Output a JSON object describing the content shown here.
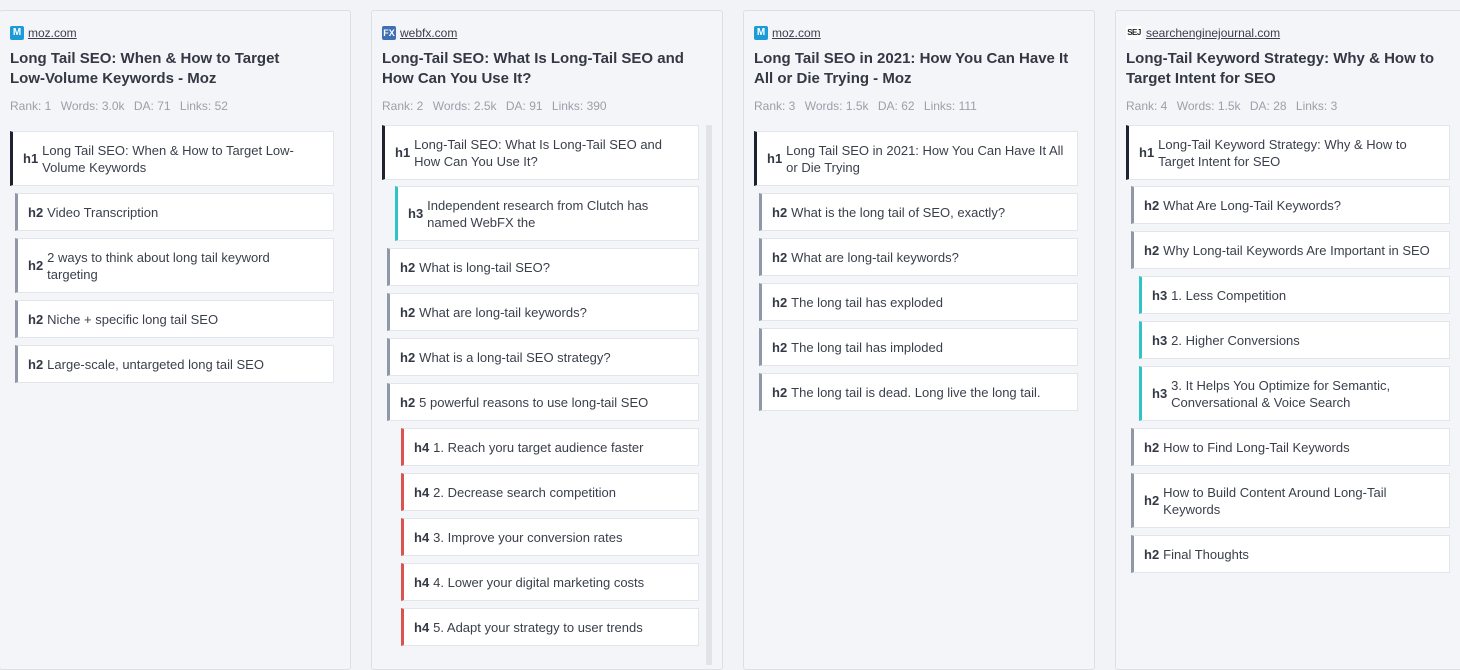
{
  "columns": [
    {
      "favicon": "moz-icon",
      "favicon_text": "M",
      "domain": "moz.com",
      "title": "Long Tail SEO: When & How to Target Low-Volume Keywords - Moz",
      "stats": {
        "rank": "Rank: 1",
        "words": "Words: 3.0k",
        "da": "DA: 71",
        "links": "Links: 52"
      },
      "headings": [
        {
          "tag": "h1",
          "text": "Long Tail SEO: When & How to Target Low-Volume Keywords"
        },
        {
          "tag": "h2",
          "text": "Video Transcription"
        },
        {
          "tag": "h2",
          "text": "2 ways to think about long tail keyword targeting"
        },
        {
          "tag": "h2",
          "text": "Niche + specific long tail SEO"
        },
        {
          "tag": "h2",
          "text": "Large-scale, untargeted long tail SEO"
        }
      ]
    },
    {
      "favicon": "webfx-icon",
      "favicon_text": "FX",
      "domain": "webfx.com",
      "title": "Long-Tail SEO: What Is Long-Tail SEO and How Can You Use It?",
      "stats": {
        "rank": "Rank: 2",
        "words": "Words: 2.5k",
        "da": "DA: 91",
        "links": "Links: 390"
      },
      "headings": [
        {
          "tag": "h1",
          "text": "Long-Tail SEO: What Is Long-Tail SEO and How Can You Use It?"
        },
        {
          "tag": "h3",
          "text": "Independent research from Clutch has named WebFX the"
        },
        {
          "tag": "h2",
          "text": "What is long-tail SEO?"
        },
        {
          "tag": "h2",
          "text": "What are long-tail keywords?"
        },
        {
          "tag": "h2",
          "text": "What is a long-tail SEO strategy?"
        },
        {
          "tag": "h2",
          "text": "5 powerful reasons to use long-tail SEO"
        },
        {
          "tag": "h4",
          "text": "1. Reach yoru target audience faster"
        },
        {
          "tag": "h4",
          "text": "2. Decrease search competition"
        },
        {
          "tag": "h4",
          "text": "3. Improve your conversion rates"
        },
        {
          "tag": "h4",
          "text": "4. Lower your digital marketing costs"
        },
        {
          "tag": "h4",
          "text": "5. Adapt your strategy to user trends"
        }
      ]
    },
    {
      "favicon": "moz-icon",
      "favicon_text": "M",
      "domain": "moz.com",
      "title": "Long Tail SEO in 2021: How You Can Have It All or Die Trying - Moz",
      "stats": {
        "rank": "Rank: 3",
        "words": "Words: 1.5k",
        "da": "DA: 62",
        "links": "Links: 111"
      },
      "headings": [
        {
          "tag": "h1",
          "text": "Long Tail SEO in 2021: How You Can Have It All or Die Trying"
        },
        {
          "tag": "h2",
          "text": "What is the long tail of SEO, exactly?"
        },
        {
          "tag": "h2",
          "text": "What are long-tail keywords?"
        },
        {
          "tag": "h2",
          "text": "The long tail has exploded"
        },
        {
          "tag": "h2",
          "text": "The long tail has imploded"
        },
        {
          "tag": "h2",
          "text": "The long tail is dead. Long live the long tail."
        }
      ]
    },
    {
      "favicon": "sej-icon",
      "favicon_text": "SEJ",
      "domain": "searchenginejournal.com",
      "title": "Long-Tail Keyword Strategy: Why & How to Target Intent for SEO",
      "stats": {
        "rank": "Rank: 4",
        "words": "Words: 1.5k",
        "da": "DA: 28",
        "links": "Links: 3"
      },
      "headings": [
        {
          "tag": "h1",
          "text": "Long-Tail Keyword Strategy: Why & How to Target Intent for SEO"
        },
        {
          "tag": "h2",
          "text": "What Are Long-Tail Keywords?"
        },
        {
          "tag": "h2",
          "text": "Why Long-tail Keywords Are Important in SEO"
        },
        {
          "tag": "h3",
          "text": "1. Less Competition"
        },
        {
          "tag": "h3",
          "text": "2. Higher Conversions"
        },
        {
          "tag": "h3",
          "text": "3. It Helps You Optimize for Semantic, Conversational & Voice Search"
        },
        {
          "tag": "h2",
          "text": "How to Find Long-Tail Keywords"
        },
        {
          "tag": "h2",
          "text": "How to Build Content Around Long-Tail Keywords"
        },
        {
          "tag": "h2",
          "text": "Final Thoughts"
        }
      ]
    }
  ]
}
